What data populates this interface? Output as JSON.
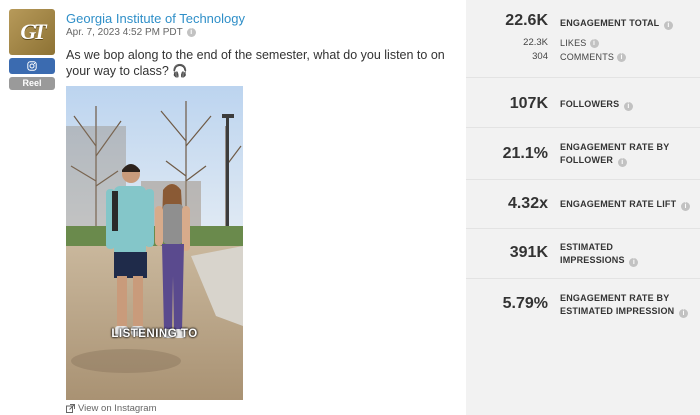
{
  "post": {
    "account_name": "Georgia Institute of Technology",
    "logo_text": "GT",
    "platform_icon": "instagram-icon",
    "type_badge": "Reel",
    "date": "Apr. 7, 2023 4:52 PM PDT",
    "caption": "As we bop along to the end of the semester, what do you listen to on your way to class? 🎧",
    "image_overlay_text": "LISTENING TO",
    "view_link": "View on Instagram"
  },
  "metrics": {
    "engagement_total": {
      "value": "22.6K",
      "label": "ENGAGEMENT TOTAL"
    },
    "likes": {
      "value": "22.3K",
      "label": "LIKES"
    },
    "comments": {
      "value": "304",
      "label": "COMMENTS"
    },
    "followers": {
      "value": "107K",
      "label": "FOLLOWERS"
    },
    "engagement_rate_by_follower": {
      "value": "21.1%",
      "label_line1": "ENGAGEMENT RATE BY",
      "label_line2": "FOLLOWER"
    },
    "engagement_rate_lift": {
      "value": "4.32x",
      "label": "ENGAGEMENT RATE LIFT"
    },
    "estimated_impressions": {
      "value": "391K",
      "label_line1": "ESTIMATED",
      "label_line2": "IMPRESSIONS"
    },
    "engagement_rate_by_impression": {
      "value": "5.79%",
      "label_line1": "ENGAGEMENT RATE BY",
      "label_line2": "ESTIMATED IMPRESSION"
    }
  },
  "colors": {
    "account_link": "#2f8fc8",
    "panel_bg": "#f2f2f2",
    "logo_gold": "#b79a5a",
    "instagram_badge": "#3b6bb0",
    "reel_badge": "#9a9a9a"
  }
}
